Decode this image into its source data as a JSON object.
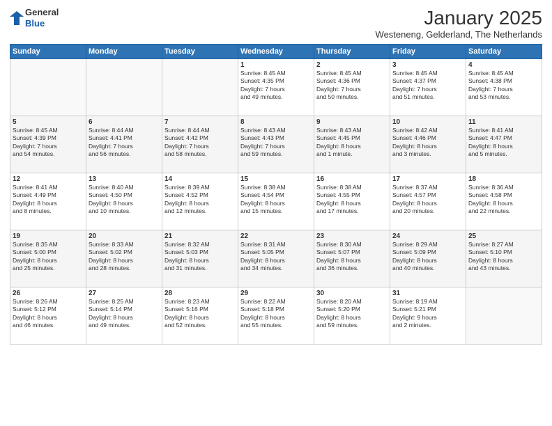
{
  "header": {
    "logo_line1": "General",
    "logo_line2": "Blue",
    "month": "January 2025",
    "location": "Westeneng, Gelderland, The Netherlands"
  },
  "weekdays": [
    "Sunday",
    "Monday",
    "Tuesday",
    "Wednesday",
    "Thursday",
    "Friday",
    "Saturday"
  ],
  "weeks": [
    [
      {
        "day": "",
        "info": ""
      },
      {
        "day": "",
        "info": ""
      },
      {
        "day": "",
        "info": ""
      },
      {
        "day": "1",
        "info": "Sunrise: 8:45 AM\nSunset: 4:35 PM\nDaylight: 7 hours\nand 49 minutes."
      },
      {
        "day": "2",
        "info": "Sunrise: 8:45 AM\nSunset: 4:36 PM\nDaylight: 7 hours\nand 50 minutes."
      },
      {
        "day": "3",
        "info": "Sunrise: 8:45 AM\nSunset: 4:37 PM\nDaylight: 7 hours\nand 51 minutes."
      },
      {
        "day": "4",
        "info": "Sunrise: 8:45 AM\nSunset: 4:38 PM\nDaylight: 7 hours\nand 53 minutes."
      }
    ],
    [
      {
        "day": "5",
        "info": "Sunrise: 8:45 AM\nSunset: 4:39 PM\nDaylight: 7 hours\nand 54 minutes."
      },
      {
        "day": "6",
        "info": "Sunrise: 8:44 AM\nSunset: 4:41 PM\nDaylight: 7 hours\nand 56 minutes."
      },
      {
        "day": "7",
        "info": "Sunrise: 8:44 AM\nSunset: 4:42 PM\nDaylight: 7 hours\nand 58 minutes."
      },
      {
        "day": "8",
        "info": "Sunrise: 8:43 AM\nSunset: 4:43 PM\nDaylight: 7 hours\nand 59 minutes."
      },
      {
        "day": "9",
        "info": "Sunrise: 8:43 AM\nSunset: 4:45 PM\nDaylight: 8 hours\nand 1 minute."
      },
      {
        "day": "10",
        "info": "Sunrise: 8:42 AM\nSunset: 4:46 PM\nDaylight: 8 hours\nand 3 minutes."
      },
      {
        "day": "11",
        "info": "Sunrise: 8:41 AM\nSunset: 4:47 PM\nDaylight: 8 hours\nand 5 minutes."
      }
    ],
    [
      {
        "day": "12",
        "info": "Sunrise: 8:41 AM\nSunset: 4:49 PM\nDaylight: 8 hours\nand 8 minutes."
      },
      {
        "day": "13",
        "info": "Sunrise: 8:40 AM\nSunset: 4:50 PM\nDaylight: 8 hours\nand 10 minutes."
      },
      {
        "day": "14",
        "info": "Sunrise: 8:39 AM\nSunset: 4:52 PM\nDaylight: 8 hours\nand 12 minutes."
      },
      {
        "day": "15",
        "info": "Sunrise: 8:38 AM\nSunset: 4:54 PM\nDaylight: 8 hours\nand 15 minutes."
      },
      {
        "day": "16",
        "info": "Sunrise: 8:38 AM\nSunset: 4:55 PM\nDaylight: 8 hours\nand 17 minutes."
      },
      {
        "day": "17",
        "info": "Sunrise: 8:37 AM\nSunset: 4:57 PM\nDaylight: 8 hours\nand 20 minutes."
      },
      {
        "day": "18",
        "info": "Sunrise: 8:36 AM\nSunset: 4:58 PM\nDaylight: 8 hours\nand 22 minutes."
      }
    ],
    [
      {
        "day": "19",
        "info": "Sunrise: 8:35 AM\nSunset: 5:00 PM\nDaylight: 8 hours\nand 25 minutes."
      },
      {
        "day": "20",
        "info": "Sunrise: 8:33 AM\nSunset: 5:02 PM\nDaylight: 8 hours\nand 28 minutes."
      },
      {
        "day": "21",
        "info": "Sunrise: 8:32 AM\nSunset: 5:03 PM\nDaylight: 8 hours\nand 31 minutes."
      },
      {
        "day": "22",
        "info": "Sunrise: 8:31 AM\nSunset: 5:05 PM\nDaylight: 8 hours\nand 34 minutes."
      },
      {
        "day": "23",
        "info": "Sunrise: 8:30 AM\nSunset: 5:07 PM\nDaylight: 8 hours\nand 36 minutes."
      },
      {
        "day": "24",
        "info": "Sunrise: 8:29 AM\nSunset: 5:09 PM\nDaylight: 8 hours\nand 40 minutes."
      },
      {
        "day": "25",
        "info": "Sunrise: 8:27 AM\nSunset: 5:10 PM\nDaylight: 8 hours\nand 43 minutes."
      }
    ],
    [
      {
        "day": "26",
        "info": "Sunrise: 8:26 AM\nSunset: 5:12 PM\nDaylight: 8 hours\nand 46 minutes."
      },
      {
        "day": "27",
        "info": "Sunrise: 8:25 AM\nSunset: 5:14 PM\nDaylight: 8 hours\nand 49 minutes."
      },
      {
        "day": "28",
        "info": "Sunrise: 8:23 AM\nSunset: 5:16 PM\nDaylight: 8 hours\nand 52 minutes."
      },
      {
        "day": "29",
        "info": "Sunrise: 8:22 AM\nSunset: 5:18 PM\nDaylight: 8 hours\nand 55 minutes."
      },
      {
        "day": "30",
        "info": "Sunrise: 8:20 AM\nSunset: 5:20 PM\nDaylight: 8 hours\nand 59 minutes."
      },
      {
        "day": "31",
        "info": "Sunrise: 8:19 AM\nSunset: 5:21 PM\nDaylight: 9 hours\nand 2 minutes."
      },
      {
        "day": "",
        "info": ""
      }
    ]
  ]
}
